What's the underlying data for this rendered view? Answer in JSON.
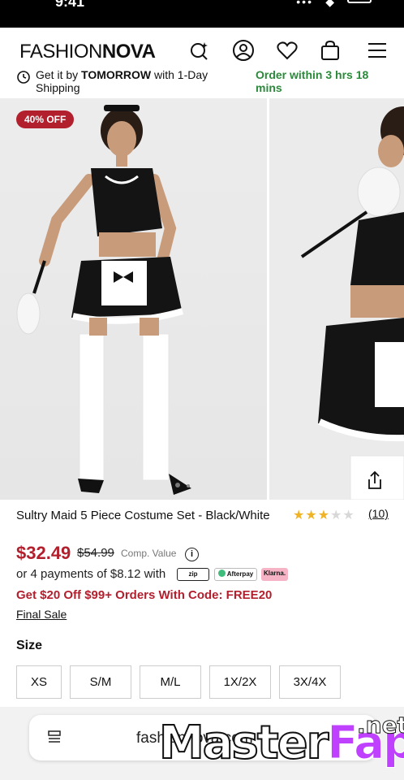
{
  "status_bar": {
    "time": "9:41"
  },
  "header": {
    "logo_left": "FASHION",
    "logo_right": "NOVA",
    "icons": [
      "sparkle-search-icon",
      "account-icon",
      "heart-icon",
      "bag-icon",
      "menu-icon"
    ]
  },
  "shipping": {
    "prefix": "Get it by ",
    "day": "TOMORROW",
    "suffix": " with 1-Day Shipping",
    "order_within": "Order within 3 hrs 18 mins"
  },
  "gallery": {
    "badge": "40% OFF",
    "image_1_alt": "model-costume-front",
    "image_2_alt": "model-costume-side"
  },
  "product": {
    "title": "Sultry Maid 5 Piece Costume Set - Black/White",
    "rating_stars": 3,
    "rating_max": 5,
    "review_count": "(10)",
    "price": "$32.49",
    "old_price": "$54.99",
    "comp_value_label": "Comp. Value",
    "payments_text": "or 4 payments of $8.12 with",
    "pay_options": [
      "zip",
      "Afterpay",
      "Klarna."
    ],
    "promo": "Get $20 Off $99+ Orders With Code: FREE20",
    "final_sale": "Final Sale"
  },
  "size": {
    "label": "Size",
    "options": [
      "XS",
      "S/M",
      "M/L",
      "1X/2X",
      "3X/4X"
    ]
  },
  "browser": {
    "url": "fashionnova.com"
  },
  "watermark": {
    "part1": "Master",
    "part2": "Fap",
    "part3": ".net"
  },
  "colors": {
    "accent_red": "#b21f2d",
    "green": "#2a8a3a",
    "star": "#f0b323"
  }
}
